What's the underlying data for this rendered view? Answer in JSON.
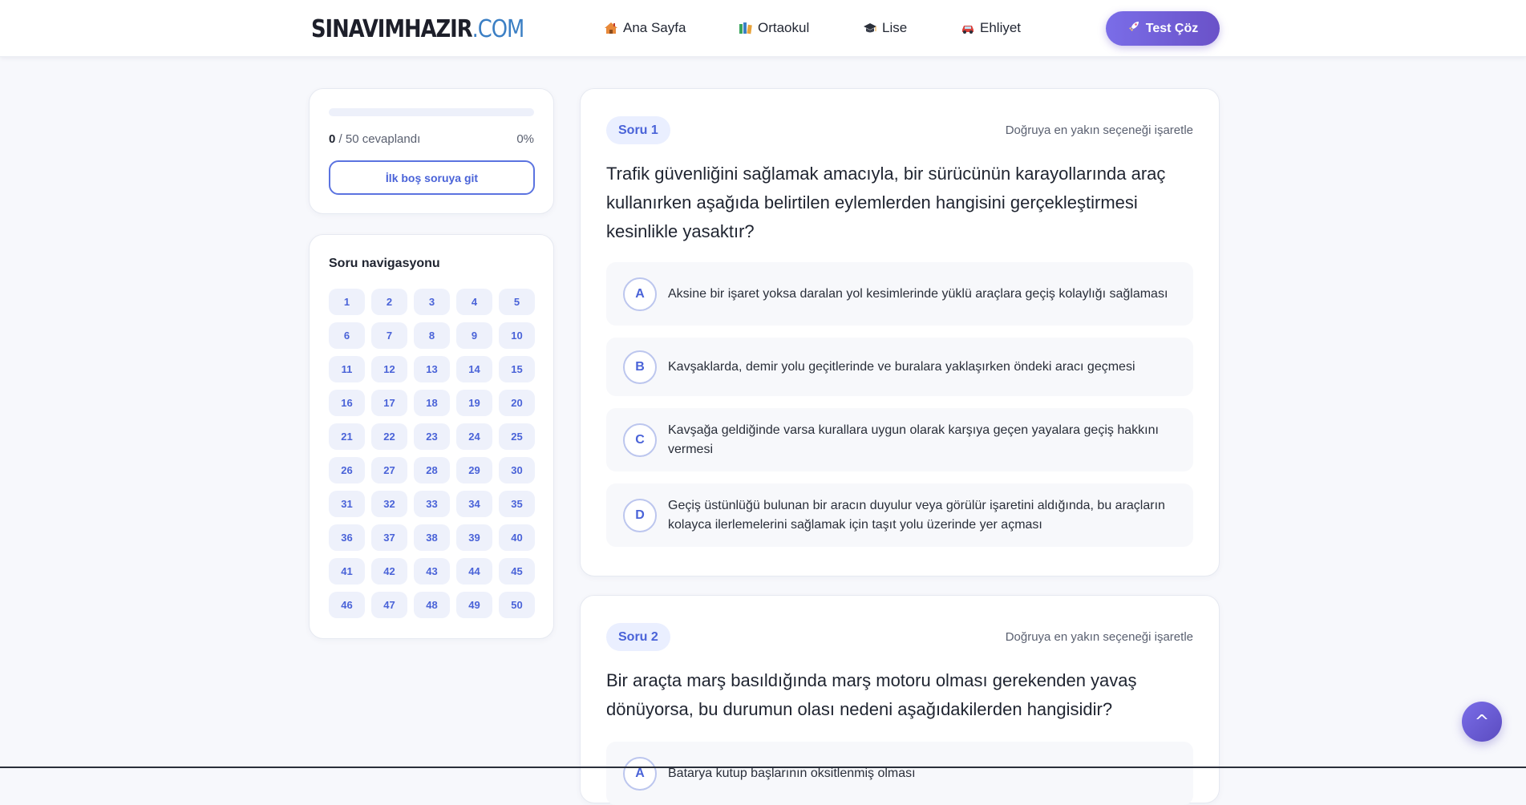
{
  "header": {
    "logo_main": "SINAVIMHAZIR",
    "logo_suffix": ".COM",
    "nav": [
      {
        "label": "Ana Sayfa",
        "icon": "home-icon"
      },
      {
        "label": "Ortaokul",
        "icon": "books-icon"
      },
      {
        "label": "Lise",
        "icon": "graduation-cap-icon"
      },
      {
        "label": "Ehliyet",
        "icon": "car-icon"
      }
    ],
    "cta_label": "Test Çöz",
    "cta_icon": "rocket-icon"
  },
  "progress": {
    "answered": "0",
    "total_text": " / 50 cevaplandı",
    "percent": "0%",
    "fill_fraction": 0,
    "first_empty_label": "İlk boş soruya git"
  },
  "navigation": {
    "title": "Soru navigasyonu",
    "numbers": [
      "1",
      "2",
      "3",
      "4",
      "5",
      "6",
      "7",
      "8",
      "9",
      "10",
      "11",
      "12",
      "13",
      "14",
      "15",
      "16",
      "17",
      "18",
      "19",
      "20",
      "21",
      "22",
      "23",
      "24",
      "25",
      "26",
      "27",
      "28",
      "29",
      "30",
      "31",
      "32",
      "33",
      "34",
      "35",
      "36",
      "37",
      "38",
      "39",
      "40",
      "41",
      "42",
      "43",
      "44",
      "45",
      "46",
      "47",
      "48",
      "49",
      "50"
    ]
  },
  "questions": [
    {
      "badge": "Soru 1",
      "hint": "Doğruya en yakın seçeneği işaretle",
      "text": "Trafik güvenliğini sağlamak amacıyla, bir sürücünün karayollarında araç kullanırken aşağıda belirtilen eylemlerden hangisini gerçekleştirmesi kesinlikle yasaktır?",
      "options": [
        {
          "letter": "A",
          "text": "Aksine bir işaret yoksa daralan yol kesimlerinde yüklü araçlara geçiş kolaylığı sağlaması"
        },
        {
          "letter": "B",
          "text": "Kavşaklarda, demir yolu geçitlerinde ve buralara yaklaşırken öndeki aracı geçmesi"
        },
        {
          "letter": "C",
          "text": "Kavşağa geldiğinde varsa kurallara uygun olarak karşıya geçen yayalara geçiş hakkını vermesi"
        },
        {
          "letter": "D",
          "text": "Geçiş üstünlüğü bulunan bir aracın duyulur veya görülür işaretini aldığında, bu araçların kolayca ilerlemelerini sağlamak için taşıt yolu üzerinde yer açması"
        }
      ]
    },
    {
      "badge": "Soru 2",
      "hint": "Doğruya en yakın seçeneği işaretle",
      "text": "Bir araçta marş basıldığında marş motoru olması gerekenden yavaş dönüyorsa, bu durumun olası nedeni aşağıdakilerden hangisidir?",
      "options": [
        {
          "letter": "A",
          "text": "Batarya kutup başlarının oksitlenmiş olması"
        }
      ]
    }
  ],
  "scroll_top_label": "^"
}
